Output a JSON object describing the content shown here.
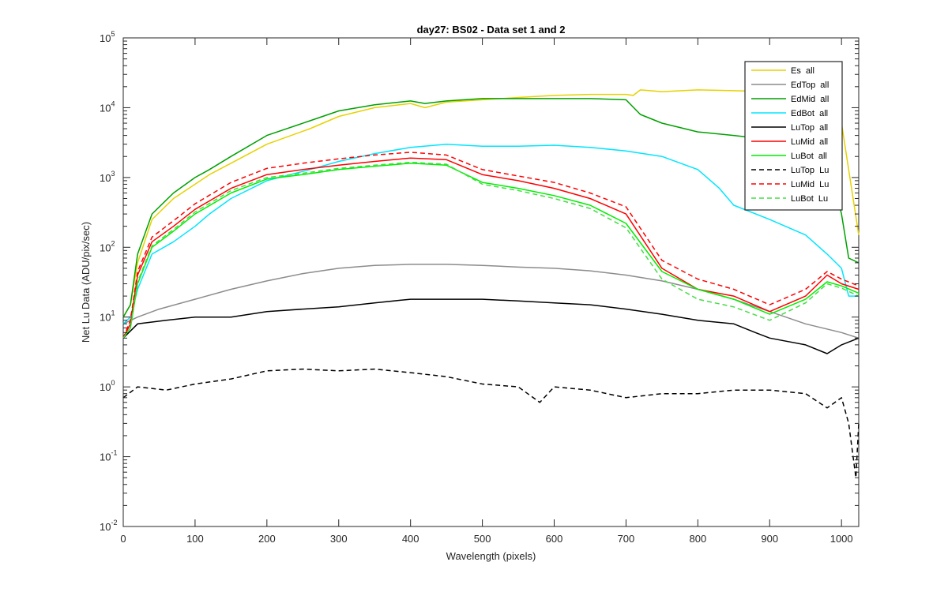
{
  "chart_data": {
    "type": "line",
    "title": "day27: BS02 - Data set 1 and 2",
    "xlabel": "Wavelength (pixels)",
    "ylabel": "Net Lu Data (ADU/pix/sec)",
    "xlim": [
      0,
      1024
    ],
    "ylim": [
      0.01,
      100000
    ],
    "yscale": "log",
    "grid": false,
    "legend_position": "top-right",
    "x_ticks": [
      "0",
      "100",
      "200",
      "300",
      "400",
      "500",
      "600",
      "700",
      "800",
      "900",
      "1000"
    ],
    "y_ticks": [
      {
        "base": "10",
        "exp": "-2"
      },
      {
        "base": "10",
        "exp": "-1"
      },
      {
        "base": "10",
        "exp": "0"
      },
      {
        "base": "10",
        "exp": "1"
      },
      {
        "base": "10",
        "exp": "2"
      },
      {
        "base": "10",
        "exp": "3"
      },
      {
        "base": "10",
        "exp": "4"
      },
      {
        "base": "10",
        "exp": "5"
      }
    ],
    "series": [
      {
        "name": "Es  all",
        "color": "#e6d200",
        "dash": "solid",
        "points": [
          [
            0,
            10
          ],
          [
            10,
            15
          ],
          [
            20,
            60
          ],
          [
            40,
            250
          ],
          [
            70,
            500
          ],
          [
            100,
            800
          ],
          [
            120,
            1100
          ],
          [
            150,
            1600
          ],
          [
            200,
            3000
          ],
          [
            260,
            5000
          ],
          [
            300,
            7500
          ],
          [
            350,
            10000
          ],
          [
            400,
            11500
          ],
          [
            420,
            10000
          ],
          [
            450,
            12000
          ],
          [
            500,
            13000
          ],
          [
            550,
            14000
          ],
          [
            600,
            15000
          ],
          [
            650,
            15500
          ],
          [
            700,
            15500
          ],
          [
            710,
            15000
          ],
          [
            720,
            18000
          ],
          [
            750,
            17000
          ],
          [
            800,
            18000
          ],
          [
            850,
            17500
          ],
          [
            900,
            17000
          ],
          [
            950,
            16500
          ],
          [
            980,
            14000
          ],
          [
            1000,
            6000
          ],
          [
            1024,
            150
          ]
        ]
      },
      {
        "name": "EdTop  all",
        "color": "#8c8c8c",
        "dash": "solid",
        "points": [
          [
            0,
            8
          ],
          [
            20,
            10
          ],
          [
            50,
            13
          ],
          [
            100,
            18
          ],
          [
            150,
            25
          ],
          [
            200,
            33
          ],
          [
            250,
            42
          ],
          [
            300,
            50
          ],
          [
            350,
            55
          ],
          [
            400,
            57
          ],
          [
            450,
            57
          ],
          [
            500,
            55
          ],
          [
            550,
            52
          ],
          [
            600,
            50
          ],
          [
            650,
            46
          ],
          [
            700,
            40
          ],
          [
            750,
            33
          ],
          [
            800,
            25
          ],
          [
            850,
            18
          ],
          [
            900,
            12
          ],
          [
            950,
            8
          ],
          [
            1000,
            6
          ],
          [
            1024,
            5
          ]
        ]
      },
      {
        "name": "EdMid  all",
        "color": "#00a000",
        "dash": "solid",
        "points": [
          [
            0,
            10
          ],
          [
            10,
            15
          ],
          [
            20,
            80
          ],
          [
            40,
            300
          ],
          [
            70,
            600
          ],
          [
            100,
            1000
          ],
          [
            120,
            1300
          ],
          [
            150,
            2000
          ],
          [
            200,
            4000
          ],
          [
            260,
            6500
          ],
          [
            300,
            9000
          ],
          [
            350,
            11000
          ],
          [
            400,
            12500
          ],
          [
            420,
            11500
          ],
          [
            450,
            12500
          ],
          [
            500,
            13500
          ],
          [
            550,
            13500
          ],
          [
            600,
            13500
          ],
          [
            650,
            13500
          ],
          [
            700,
            13000
          ],
          [
            720,
            8000
          ],
          [
            750,
            6000
          ],
          [
            800,
            4500
          ],
          [
            850,
            4000
          ],
          [
            900,
            3500
          ],
          [
            950,
            3000
          ],
          [
            980,
            2000
          ],
          [
            1000,
            300
          ],
          [
            1010,
            70
          ],
          [
            1024,
            60
          ]
        ]
      },
      {
        "name": "EdBot  all",
        "color": "#00e5ff",
        "dash": "solid",
        "points": [
          [
            0,
            8
          ],
          [
            10,
            10
          ],
          [
            20,
            25
          ],
          [
            40,
            80
          ],
          [
            70,
            120
          ],
          [
            100,
            200
          ],
          [
            120,
            300
          ],
          [
            150,
            500
          ],
          [
            200,
            900
          ],
          [
            260,
            1300
          ],
          [
            300,
            1700
          ],
          [
            350,
            2200
          ],
          [
            400,
            2700
          ],
          [
            450,
            3000
          ],
          [
            500,
            2800
          ],
          [
            550,
            2800
          ],
          [
            600,
            2900
          ],
          [
            650,
            2700
          ],
          [
            700,
            2400
          ],
          [
            750,
            2000
          ],
          [
            800,
            1300
          ],
          [
            830,
            700
          ],
          [
            850,
            400
          ],
          [
            900,
            250
          ],
          [
            950,
            150
          ],
          [
            980,
            80
          ],
          [
            1000,
            50
          ],
          [
            1010,
            20
          ],
          [
            1024,
            20
          ]
        ]
      },
      {
        "name": "LuTop  all",
        "color": "#000000",
        "dash": "solid",
        "points": [
          [
            0,
            5
          ],
          [
            20,
            8
          ],
          [
            60,
            9
          ],
          [
            100,
            10
          ],
          [
            150,
            10
          ],
          [
            200,
            12
          ],
          [
            250,
            13
          ],
          [
            300,
            14
          ],
          [
            350,
            16
          ],
          [
            400,
            18
          ],
          [
            450,
            18
          ],
          [
            500,
            18
          ],
          [
            550,
            17
          ],
          [
            600,
            16
          ],
          [
            650,
            15
          ],
          [
            700,
            13
          ],
          [
            750,
            11
          ],
          [
            800,
            9
          ],
          [
            850,
            8
          ],
          [
            880,
            6
          ],
          [
            900,
            5
          ],
          [
            950,
            4
          ],
          [
            980,
            3
          ],
          [
            1000,
            4
          ],
          [
            1024,
            5
          ]
        ]
      },
      {
        "name": "LuMid  all",
        "color": "#ff0000",
        "dash": "solid",
        "points": [
          [
            0,
            5
          ],
          [
            10,
            8
          ],
          [
            20,
            40
          ],
          [
            40,
            120
          ],
          [
            70,
            200
          ],
          [
            100,
            350
          ],
          [
            150,
            700
          ],
          [
            200,
            1100
          ],
          [
            250,
            1300
          ],
          [
            300,
            1500
          ],
          [
            350,
            1700
          ],
          [
            400,
            1900
          ],
          [
            450,
            1800
          ],
          [
            500,
            1100
          ],
          [
            550,
            900
          ],
          [
            600,
            700
          ],
          [
            650,
            500
          ],
          [
            700,
            300
          ],
          [
            750,
            50
          ],
          [
            800,
            25
          ],
          [
            850,
            20
          ],
          [
            900,
            12
          ],
          [
            950,
            20
          ],
          [
            980,
            40
          ],
          [
            1000,
            30
          ],
          [
            1024,
            25
          ]
        ]
      },
      {
        "name": "LuBot  all",
        "color": "#00ee00",
        "dash": "solid",
        "points": [
          [
            0,
            5
          ],
          [
            10,
            7
          ],
          [
            20,
            30
          ],
          [
            40,
            100
          ],
          [
            70,
            170
          ],
          [
            100,
            300
          ],
          [
            150,
            600
          ],
          [
            200,
            950
          ],
          [
            250,
            1100
          ],
          [
            300,
            1300
          ],
          [
            350,
            1450
          ],
          [
            400,
            1600
          ],
          [
            450,
            1500
          ],
          [
            500,
            850
          ],
          [
            550,
            700
          ],
          [
            600,
            550
          ],
          [
            650,
            400
          ],
          [
            700,
            220
          ],
          [
            750,
            45
          ],
          [
            800,
            25
          ],
          [
            850,
            18
          ],
          [
            900,
            11
          ],
          [
            950,
            18
          ],
          [
            980,
            32
          ],
          [
            1000,
            28
          ],
          [
            1024,
            22
          ]
        ]
      },
      {
        "name": "LuTop  Lu",
        "color": "#000000",
        "dash": "dash",
        "points": [
          [
            0,
            0.7
          ],
          [
            20,
            1
          ],
          [
            60,
            0.9
          ],
          [
            100,
            1.1
          ],
          [
            150,
            1.3
          ],
          [
            200,
            1.7
          ],
          [
            250,
            1.8
          ],
          [
            300,
            1.7
          ],
          [
            350,
            1.8
          ],
          [
            400,
            1.6
          ],
          [
            450,
            1.4
          ],
          [
            500,
            1.1
          ],
          [
            550,
            1
          ],
          [
            580,
            0.6
          ],
          [
            600,
            1
          ],
          [
            650,
            0.9
          ],
          [
            700,
            0.7
          ],
          [
            750,
            0.8
          ],
          [
            800,
            0.8
          ],
          [
            850,
            0.9
          ],
          [
            900,
            0.9
          ],
          [
            950,
            0.8
          ],
          [
            980,
            0.5
          ],
          [
            1000,
            0.7
          ],
          [
            1010,
            0.3
          ],
          [
            1020,
            0.05
          ],
          [
            1024,
            0.3
          ]
        ]
      },
      {
        "name": "LuMid  Lu",
        "color": "#ff0000",
        "dash": "dash",
        "points": [
          [
            0,
            5
          ],
          [
            10,
            9
          ],
          [
            20,
            45
          ],
          [
            40,
            140
          ],
          [
            70,
            240
          ],
          [
            100,
            420
          ],
          [
            150,
            850
          ],
          [
            200,
            1350
          ],
          [
            250,
            1600
          ],
          [
            300,
            1850
          ],
          [
            350,
            2100
          ],
          [
            400,
            2300
          ],
          [
            450,
            2100
          ],
          [
            500,
            1300
          ],
          [
            550,
            1050
          ],
          [
            600,
            850
          ],
          [
            650,
            600
          ],
          [
            700,
            380
          ],
          [
            750,
            65
          ],
          [
            800,
            35
          ],
          [
            850,
            25
          ],
          [
            900,
            15
          ],
          [
            950,
            25
          ],
          [
            980,
            45
          ],
          [
            1000,
            35
          ],
          [
            1024,
            28
          ]
        ]
      },
      {
        "name": "LuBot  Lu",
        "color": "#44dd44",
        "dash": "dash",
        "points": [
          [
            0,
            5
          ],
          [
            10,
            7
          ],
          [
            20,
            32
          ],
          [
            40,
            105
          ],
          [
            70,
            180
          ],
          [
            100,
            320
          ],
          [
            150,
            650
          ],
          [
            200,
            1000
          ],
          [
            250,
            1150
          ],
          [
            300,
            1350
          ],
          [
            350,
            1500
          ],
          [
            400,
            1650
          ],
          [
            450,
            1550
          ],
          [
            500,
            800
          ],
          [
            550,
            650
          ],
          [
            600,
            500
          ],
          [
            650,
            360
          ],
          [
            700,
            190
          ],
          [
            750,
            35
          ],
          [
            800,
            18
          ],
          [
            850,
            14
          ],
          [
            900,
            9
          ],
          [
            950,
            16
          ],
          [
            980,
            30
          ],
          [
            1000,
            26
          ],
          [
            1024,
            20
          ]
        ]
      }
    ]
  }
}
